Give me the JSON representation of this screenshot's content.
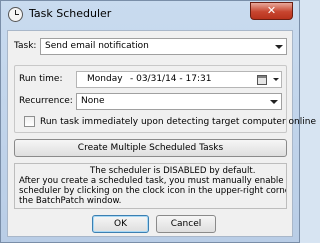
{
  "window": {
    "title": "Task Scheduler",
    "close_glyph": "✕"
  },
  "task": {
    "label": "Task:",
    "selected": "Send email notification"
  },
  "schedule": {
    "run_time_label": "Run time:",
    "run_time_day": "Monday",
    "run_time_value": "- 03/31/14 - 17:31",
    "recurrence_label": "Recurrence:",
    "recurrence_selected": "None",
    "run_immediately_label": "Run task immediately upon detecting target computer online",
    "run_immediately_checked": false
  },
  "create_multiple_button": "Create Multiple Scheduled Tasks",
  "info": {
    "lines": [
      "The scheduler is DISABLED by default.",
      "After you create a scheduled task, you must manually enable the",
      "scheduler by clicking on the clock icon in the upper-right corner of",
      "the BatchPatch window."
    ]
  },
  "buttons": {
    "ok": "OK",
    "cancel": "Cancel"
  },
  "icons": {
    "app": "clock-icon",
    "calendar": "calendar-icon",
    "dropdown": "chevron-down-icon"
  }
}
